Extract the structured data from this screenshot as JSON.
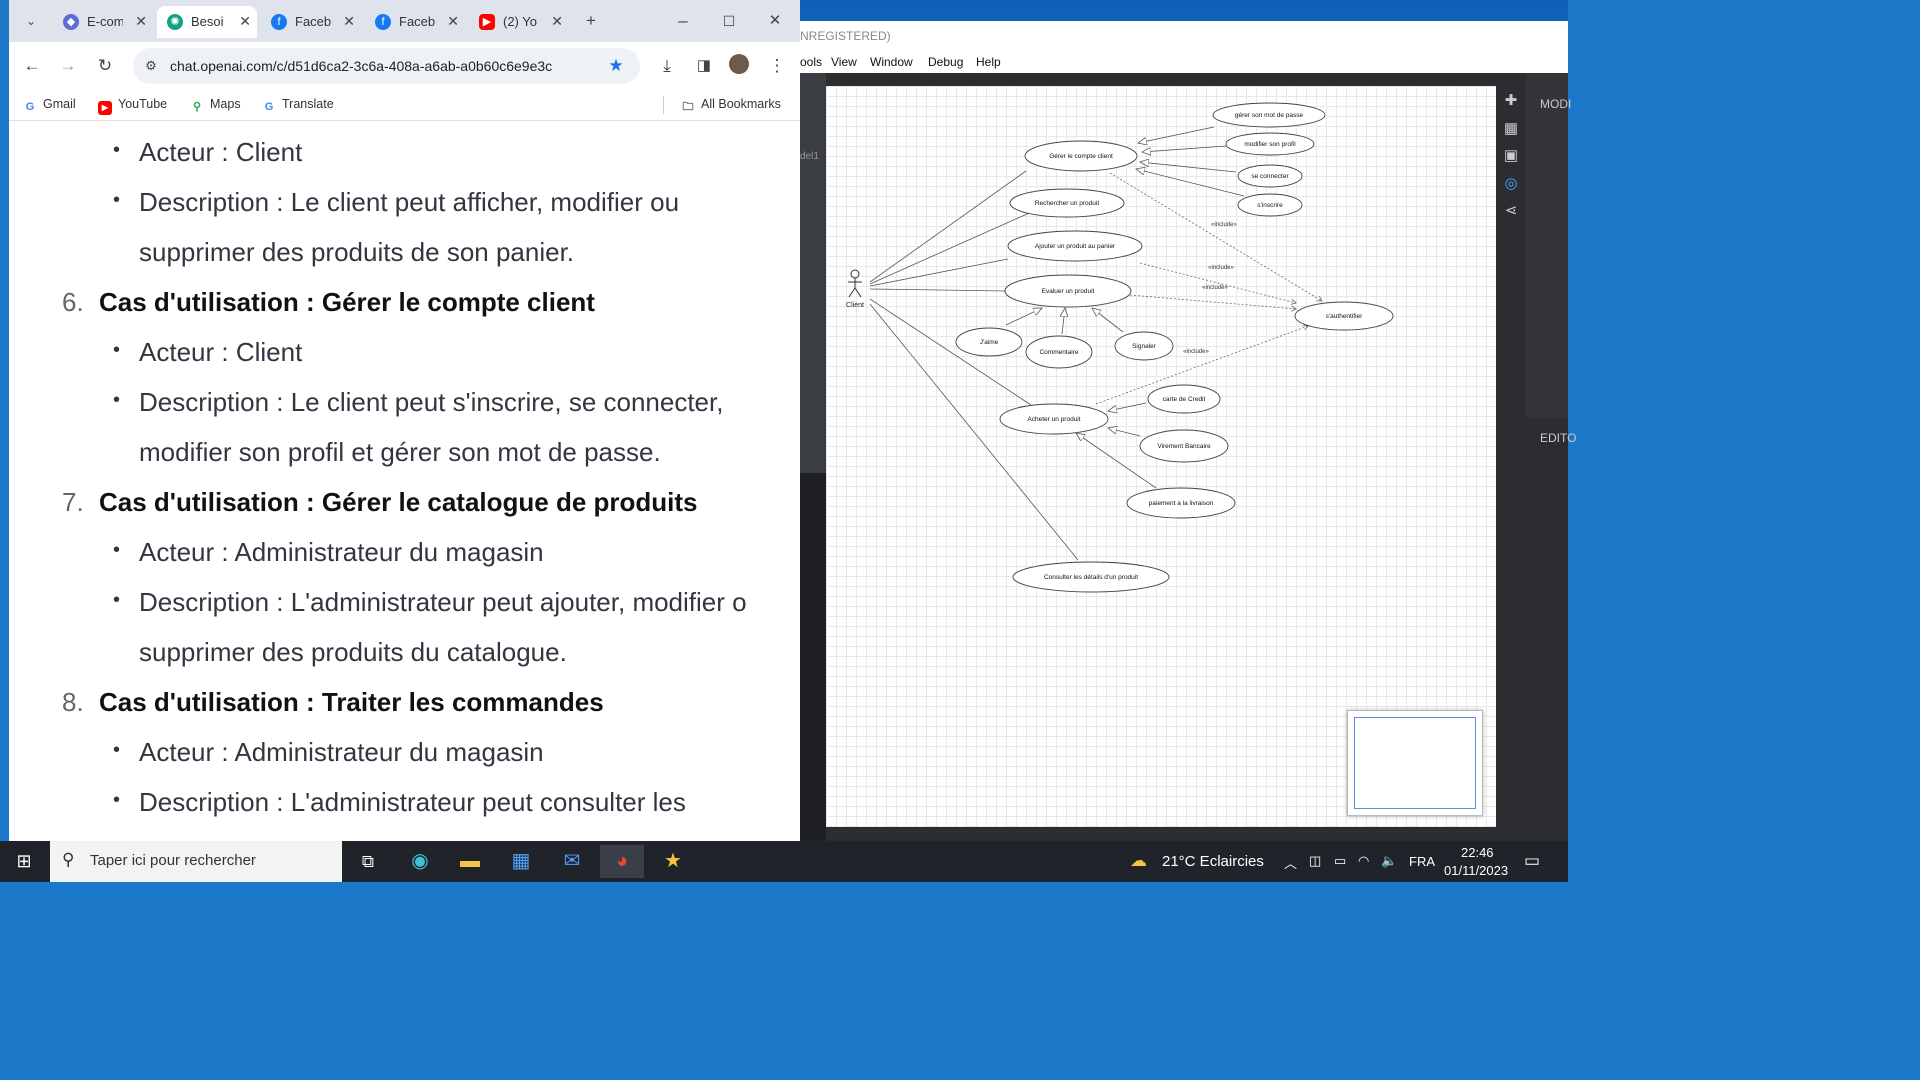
{
  "chrome": {
    "tabs": [
      {
        "label": "E-com",
        "icon": "site-icon",
        "color": "#5f6bd8"
      },
      {
        "label": "Besoi",
        "icon": "openai-icon",
        "color": "#10a37f"
      },
      {
        "label": "Faceb",
        "icon": "facebook-icon",
        "color": "#1877f2"
      },
      {
        "label": "Faceb",
        "icon": "facebook-icon",
        "color": "#1877f2"
      },
      {
        "label": "(2) Yo",
        "icon": "youtube-icon",
        "color": "#ff0000"
      }
    ],
    "url": "chat.openai.com/c/d51d6ca2-3c6a-408a-a6ab-a0b60c6e9e3c",
    "bookmarks": [
      "Gmail",
      "YouTube",
      "Maps",
      "Translate"
    ],
    "all_bookmarks": "All Bookmarks"
  },
  "doc": {
    "item5_actor": "Acteur : Client",
    "item5_desc_1": "Description : Le client peut afficher, modifier ou",
    "item5_desc_2": "supprimer des produits de son panier.",
    "item6_num": "6.",
    "item6_title": "Cas d'utilisation : Gérer le compte client",
    "item6_actor": "Acteur : Client",
    "item6_desc_1": "Description : Le client peut s'inscrire, se connecter,",
    "item6_desc_2": "modifier son profil et gérer son mot de passe.",
    "item7_num": "7.",
    "item7_title": "Cas d'utilisation : Gérer le catalogue de produits",
    "item7_actor": "Acteur : Administrateur du magasin",
    "item7_desc_1": "Description : L'administrateur peut ajouter, modifier o",
    "item7_desc_2": "supprimer des produits du catalogue.",
    "item8_num": "8.",
    "item8_title": "Cas d'utilisation : Traiter les commandes",
    "item8_actor": "Acteur : Administrateur du magasin",
    "item8_desc_1": "Description : L'administrateur peut consulter les"
  },
  "staruml": {
    "title": "NREGISTERED)",
    "menu": [
      "ools",
      "View",
      "Window",
      "Debug",
      "Help"
    ],
    "left_tab": "del1",
    "panel_header": "MODI",
    "panel_header2": "EDITO"
  },
  "diagram": {
    "actor": "Client",
    "usecases": {
      "gerer_compte": "Gérer le compte client",
      "mot_de_passe": "gérer son mot de passe",
      "modifier_profil": "modifier son profil",
      "se_connecter": "se connecter",
      "inscrire": "s'inscrire",
      "rechercher": "Rechercher un produit",
      "ajouter_panier": "Ajouter un produit au panier",
      "evaluer": "Evaluer un produit",
      "jaime": "J'aime",
      "commentaire": "Commentaire",
      "signaler": "Signaler",
      "authentifier": "s'authentifier",
      "acheter": "Acheter un produit",
      "carte": "carte de Credit",
      "virement": "Virement Bancaire",
      "paiement": "paiement a la livraison",
      "consulter": "Consulter les détails d'un produit"
    },
    "include_label": "«include»"
  },
  "taskbar": {
    "search_placeholder": "Taper ici pour rechercher",
    "weather": "21°C  Eclaircies",
    "lang": "FRA",
    "time": "22:46",
    "date": "01/11/2023"
  }
}
